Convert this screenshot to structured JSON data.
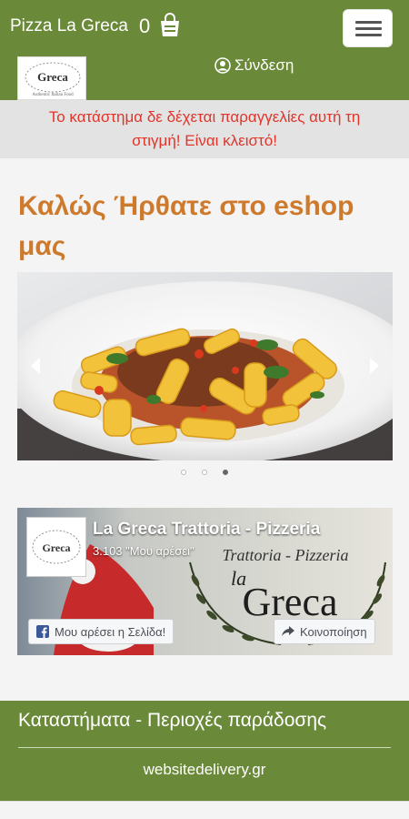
{
  "header": {
    "brand": "Pizza La Greca",
    "cart_count": "0",
    "login_label": "Σύνδεση",
    "logo_text_top": "Greca",
    "logo_text_bottom": "Authentic Italian Food"
  },
  "notice": {
    "line1": "Το κατάστημα δε δέχεται παραγγελίες αυτή τη",
    "line2": "στιγμή! Είναι κλειστό!"
  },
  "welcome": {
    "line1": "Καλώς Ήρθατε στο eshop",
    "line2": "μας"
  },
  "carousel": {
    "slide_count": 3,
    "active_index": 2
  },
  "facebook": {
    "page_name": "La Greca Trattoria - Pizzeria",
    "likes": "3.103 \"Μου αρέσει\"",
    "like_button": "Μου αρέσει η Σελίδα!",
    "share_button": "Κοινοποίηση",
    "cover_subtitle": "Trattoria - Pizzeria",
    "cover_la": "la",
    "cover_title": "Greca"
  },
  "footer": {
    "stores_link": "Καταστήματα - Περιοχές παράδοσης",
    "site": "websitedelivery.gr"
  },
  "colors": {
    "brand_green": "#6a8a3a",
    "notice_red": "#e2342a",
    "welcome_orange": "#cd7a2d"
  },
  "icons": [
    "cart-icon",
    "menu-icon",
    "user-icon",
    "arrow-left-icon",
    "arrow-right-icon",
    "facebook-icon",
    "share-icon"
  ]
}
